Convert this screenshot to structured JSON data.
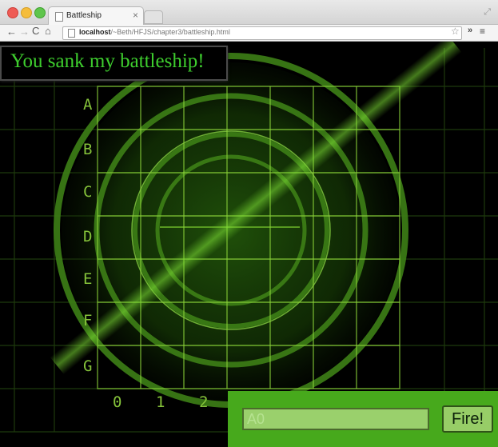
{
  "browser": {
    "tab_title": "Battleship",
    "tab_close": "×",
    "url_host": "localhost",
    "url_path": "/~Beth/HFJS/chapter3/battleship.html",
    "back_icon": "←",
    "forward_icon": "→",
    "reload_icon": "C",
    "home_icon": "⌂",
    "star_icon": "☆",
    "extensions_icon": "»",
    "menu_icon": "≡",
    "resize_icon": "⤢"
  },
  "game": {
    "message": "You sank my battleship!",
    "rows": [
      "A",
      "B",
      "C",
      "D",
      "E",
      "F",
      "G"
    ],
    "columns": [
      "0",
      "1",
      "2"
    ],
    "guess_value": "A0",
    "fire_label": "Fire!"
  },
  "colors": {
    "grid": "#8bd13a",
    "message_text": "#3ece2e",
    "panel": "#47a91c",
    "radar": "#2f6614"
  }
}
